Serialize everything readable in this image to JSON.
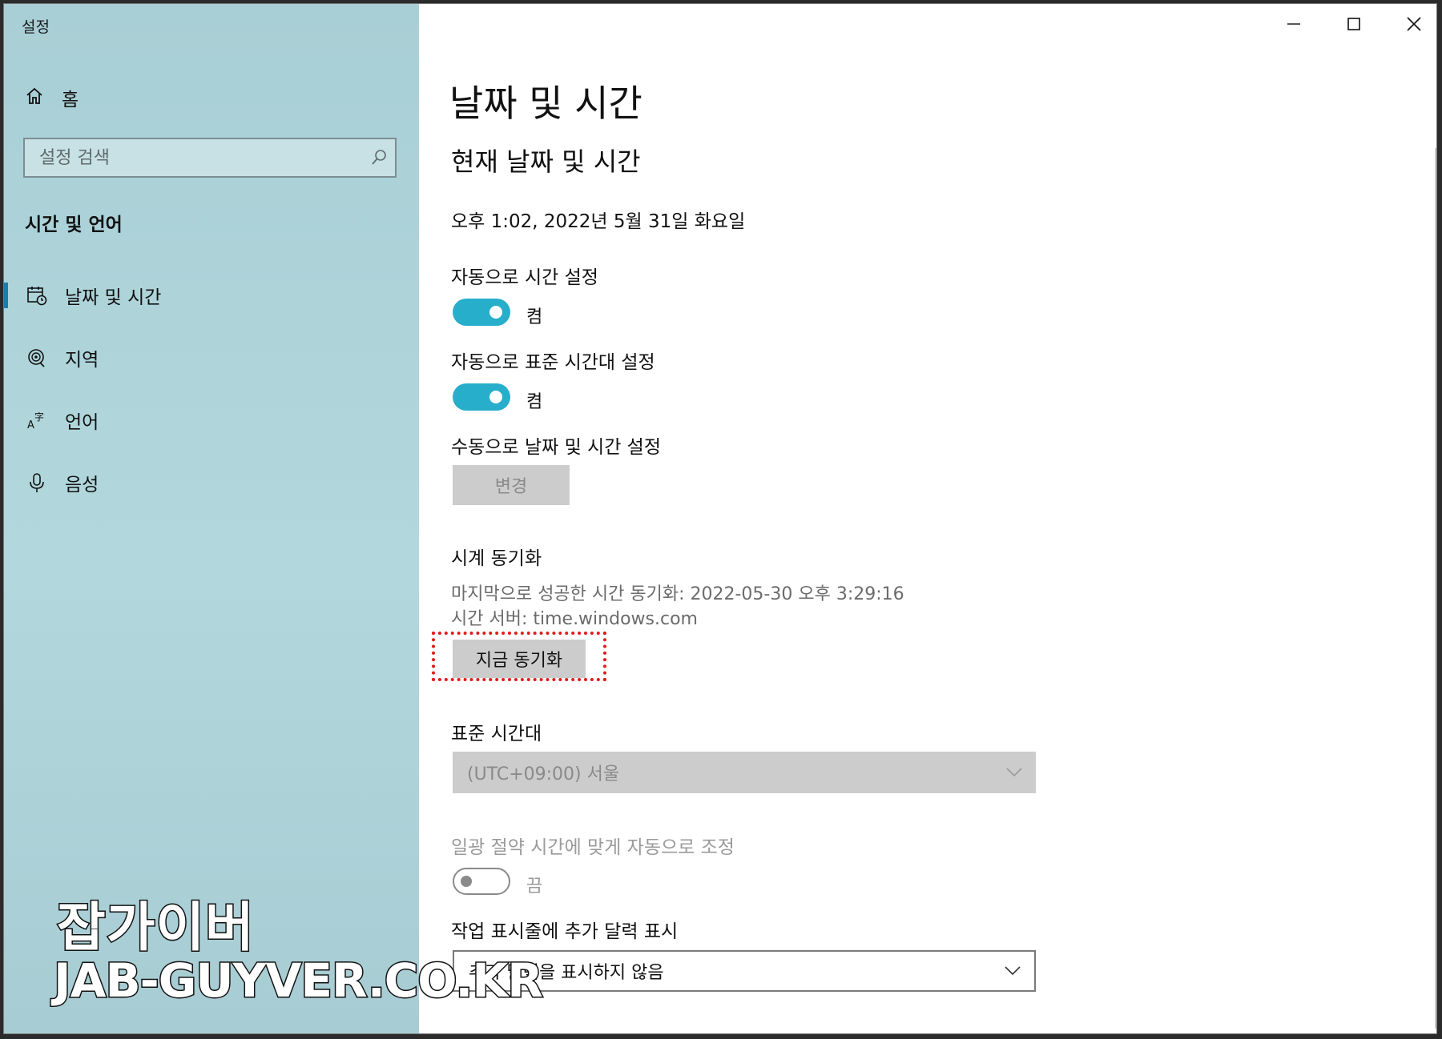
{
  "window": {
    "title": "설정"
  },
  "sidebar": {
    "home_label": "홈",
    "search_placeholder": "설정 검색",
    "section_title": "시간 및 언어",
    "items": [
      {
        "label": "날짜 및 시간",
        "icon": "calendar-clock-icon",
        "selected": true
      },
      {
        "label": "지역",
        "icon": "globe-icon"
      },
      {
        "label": "언어",
        "icon": "language-icon"
      },
      {
        "label": "음성",
        "icon": "microphone-icon"
      }
    ]
  },
  "main": {
    "page_title": "날짜 및 시간",
    "subtitle": "현재 날짜 및 시간",
    "current_datetime": "오후 1:02, 2022년 5월 31일 화요일",
    "auto_time": {
      "label": "자동으로 시간 설정",
      "state": "켬",
      "on": true
    },
    "auto_timezone": {
      "label": "자동으로 표준 시간대 설정",
      "state": "켬",
      "on": true
    },
    "manual": {
      "label": "수동으로 날짜 및 시간 설정",
      "button": "변경"
    },
    "sync": {
      "title": "시계 동기화",
      "last_success": "마지막으로 성공한 시간 동기화: 2022-05-30 오후 3:29:16",
      "server": "시간 서버: time.windows.com",
      "button": "지금 동기화"
    },
    "timezone": {
      "label": "표준 시간대",
      "value": "(UTC+09:00) 서울"
    },
    "dst": {
      "label": "일광 절약 시간에 맞게 자동으로 조정",
      "state": "끔",
      "on": false
    },
    "taskbar_calendar": {
      "label": "작업 표시줄에 추가 달력 표시",
      "value": "추가 달력을 표시하지 않음"
    }
  },
  "watermark": {
    "line1": "잡가이버",
    "line2": "JAB-GUYVER.CO.KR"
  },
  "colors": {
    "accent": "#27aecb",
    "sidebar": "#acd3d9",
    "highlight": "#e21b1b"
  }
}
